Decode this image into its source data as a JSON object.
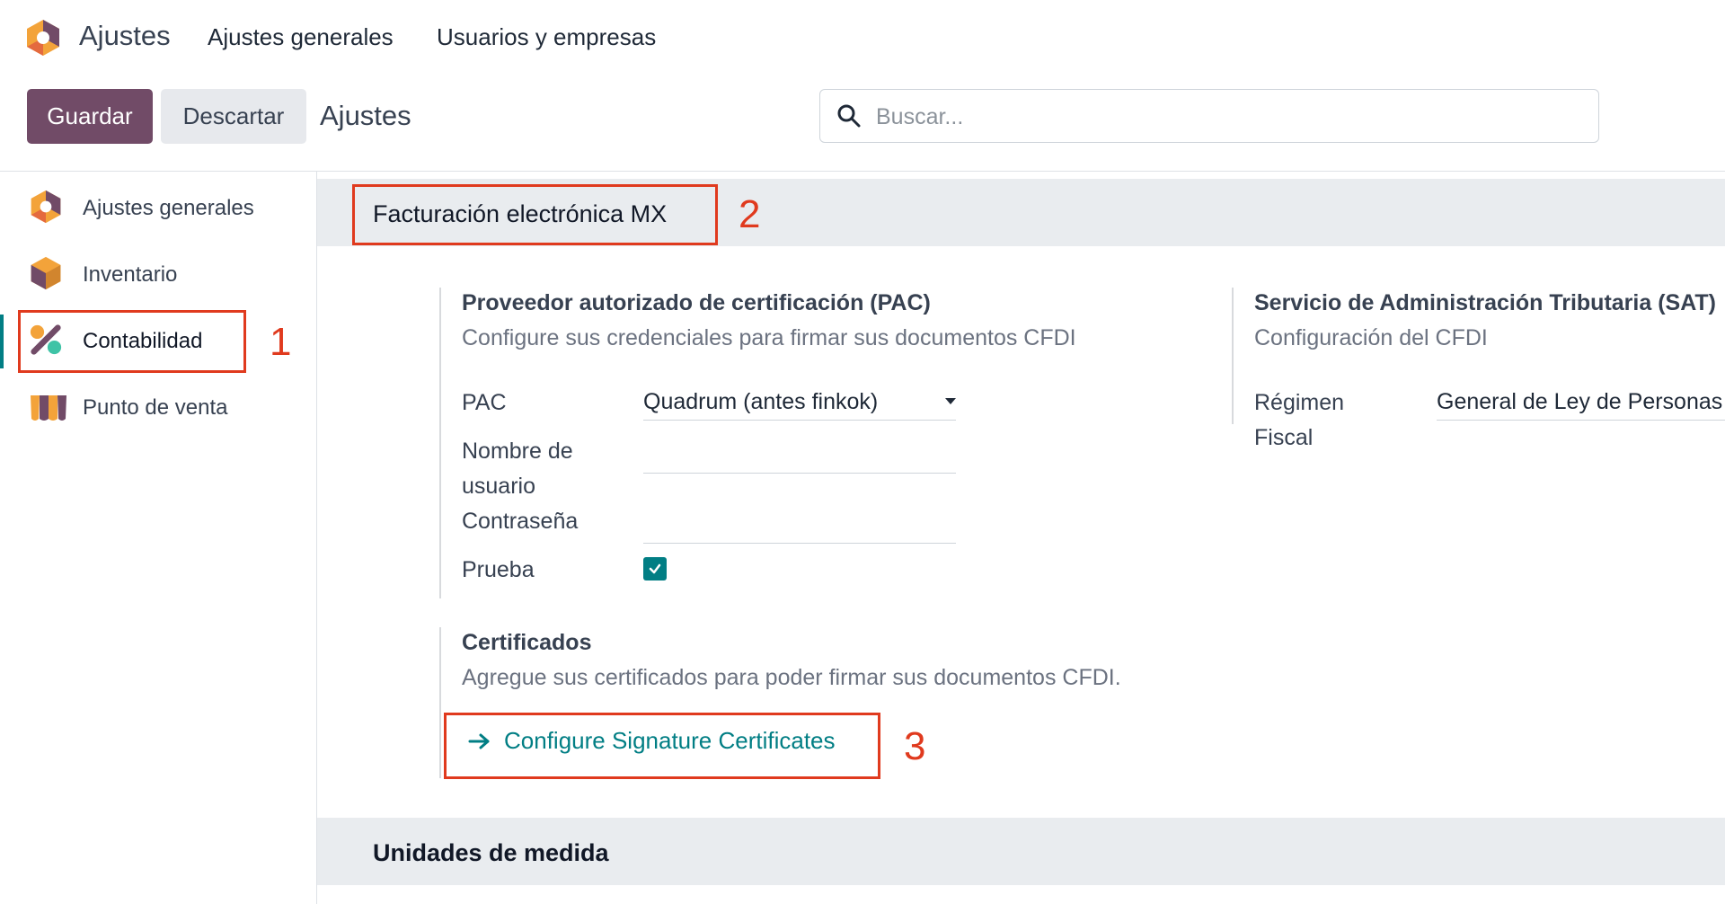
{
  "app": {
    "title": "Ajustes"
  },
  "top_menu": {
    "items": [
      "Ajustes generales",
      "Usuarios y empresas"
    ]
  },
  "control_panel": {
    "save_label": "Guardar",
    "discard_label": "Descartar",
    "breadcrumb": "Ajustes",
    "search_placeholder": "Buscar..."
  },
  "sidebar": {
    "items": [
      {
        "label": "Ajustes generales",
        "icon": "settings-app-icon"
      },
      {
        "label": "Inventario",
        "icon": "inventory-app-icon"
      },
      {
        "label": "Contabilidad",
        "icon": "accounting-app-icon",
        "active": true
      },
      {
        "label": "Punto de venta",
        "icon": "pos-app-icon"
      }
    ]
  },
  "section_mx": {
    "title": "Facturación electrónica MX",
    "pac": {
      "title": "Proveedor autorizado de certificación (PAC)",
      "description": "Configure sus credenciales para firmar sus documentos CFDI",
      "fields": {
        "pac_label": "PAC",
        "pac_value": "Quadrum (antes finkok)",
        "username_label_1": "Nombre de",
        "username_label_2": "usuario",
        "password_label": "Contraseña",
        "test_label": "Prueba",
        "test_checked": true
      }
    },
    "sat": {
      "title": "Servicio de Administración Tributaria (SAT)",
      "description": "Configuración del CFDI",
      "regime_label_1": "Régimen",
      "regime_label_2": "Fiscal",
      "regime_value": "General de Ley de Personas Morales"
    },
    "certificates": {
      "title": "Certificados",
      "description": "Agregue sus certificados para poder firmar sus documentos CFDI.",
      "link_label": "Configure Signature Certificates"
    }
  },
  "section_units": {
    "title": "Unidades de medida"
  },
  "annotations": {
    "n1": "1",
    "n2": "2",
    "n3": "3"
  },
  "colors": {
    "primary": "#714b67",
    "accent": "#017e84",
    "annotation": "#e03a1e",
    "section_bg": "#e9ecef"
  }
}
